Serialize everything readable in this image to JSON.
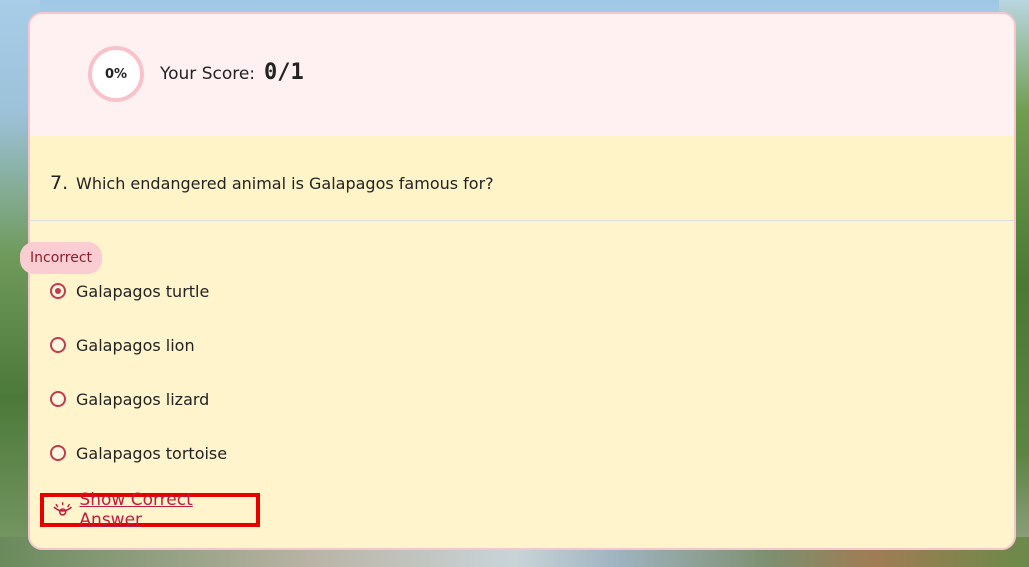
{
  "score": {
    "percent": "0%",
    "label": "Your Score:",
    "value": "0/1"
  },
  "question": {
    "number": "7.",
    "text": "Which endangered animal is Galapagos famous for?"
  },
  "feedback": {
    "badge": "Incorrect"
  },
  "options": [
    {
      "label": "Galapagos turtle",
      "selected": true
    },
    {
      "label": "Galapagos lion",
      "selected": false
    },
    {
      "label": "Galapagos lizard",
      "selected": false
    },
    {
      "label": "Galapagos tortoise",
      "selected": false
    }
  ],
  "actions": {
    "show_answer": "Show Correct Answer",
    "show_answer_icon": "eye-icon"
  },
  "colors": {
    "accent": "#c33b4a",
    "link": "#c01b3c",
    "highlight_border": "#e60000",
    "score_band": "#fff0f1",
    "question_band": "#fff4c8"
  }
}
